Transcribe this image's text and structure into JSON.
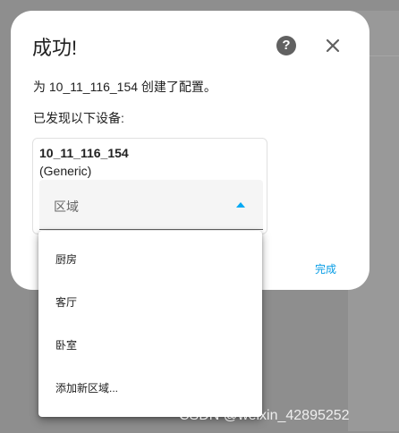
{
  "dialog": {
    "title": "成功!",
    "message": "为 10_11_116_154 创建了配置。",
    "found_label": "已发现以下设备:",
    "help_icon_glyph": "?",
    "finish_label": "完成"
  },
  "device": {
    "name": "10_11_116_154",
    "model": "(Generic)",
    "area_label": "区域"
  },
  "menu": {
    "items": [
      "厨房",
      "客厅",
      "卧室",
      "添加新区域..."
    ]
  },
  "watermark": "CSDN @weixin_42895252",
  "colors": {
    "accent": "#03a9f4",
    "backdrop": "#8e8e8e",
    "text": "#212121"
  }
}
